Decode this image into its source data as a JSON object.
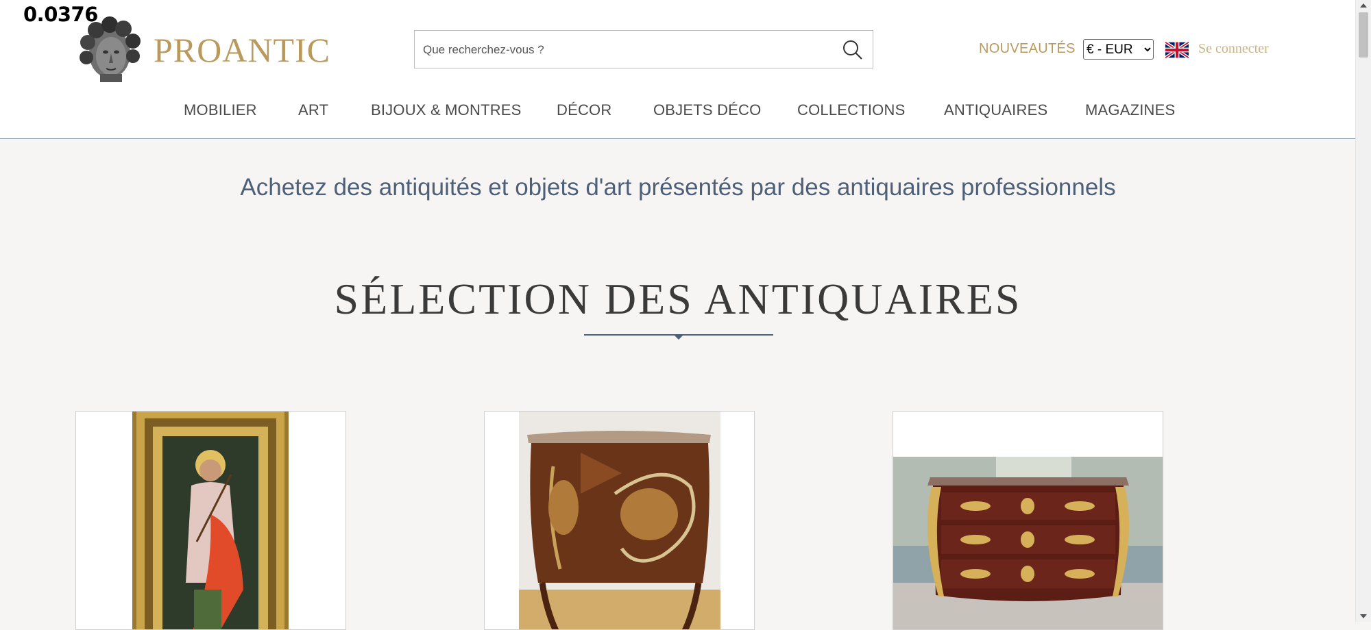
{
  "overlay": {
    "value": "0.0376"
  },
  "brand": {
    "name": "PROANTIC"
  },
  "search": {
    "placeholder": "Que recherchez-vous ?"
  },
  "header": {
    "new_label": "NOUVEAUTÉS",
    "currency_selected": "€ - EUR",
    "login_label": "Se connecter",
    "language_icon": "uk-flag-icon"
  },
  "nav": {
    "items": [
      {
        "label": "MOBILIER"
      },
      {
        "label": "ART"
      },
      {
        "label": "BIJOUX & MONTRES"
      },
      {
        "label": "DÉCOR"
      },
      {
        "label": "OBJETS DÉCO"
      },
      {
        "label": "COLLECTIONS"
      },
      {
        "label": "ANTIQUAIRES"
      },
      {
        "label": "MAGAZINES"
      }
    ]
  },
  "main": {
    "tagline": "Achetez des antiquités et objets d'art présentés par des antiquaires professionnels",
    "section_title": "SÉLECTION DES ANTIQUAIRES"
  },
  "colors": {
    "brand_gold": "#b99a5c",
    "tagline_blue": "#4e5f78",
    "background": "#f6f5f3"
  }
}
